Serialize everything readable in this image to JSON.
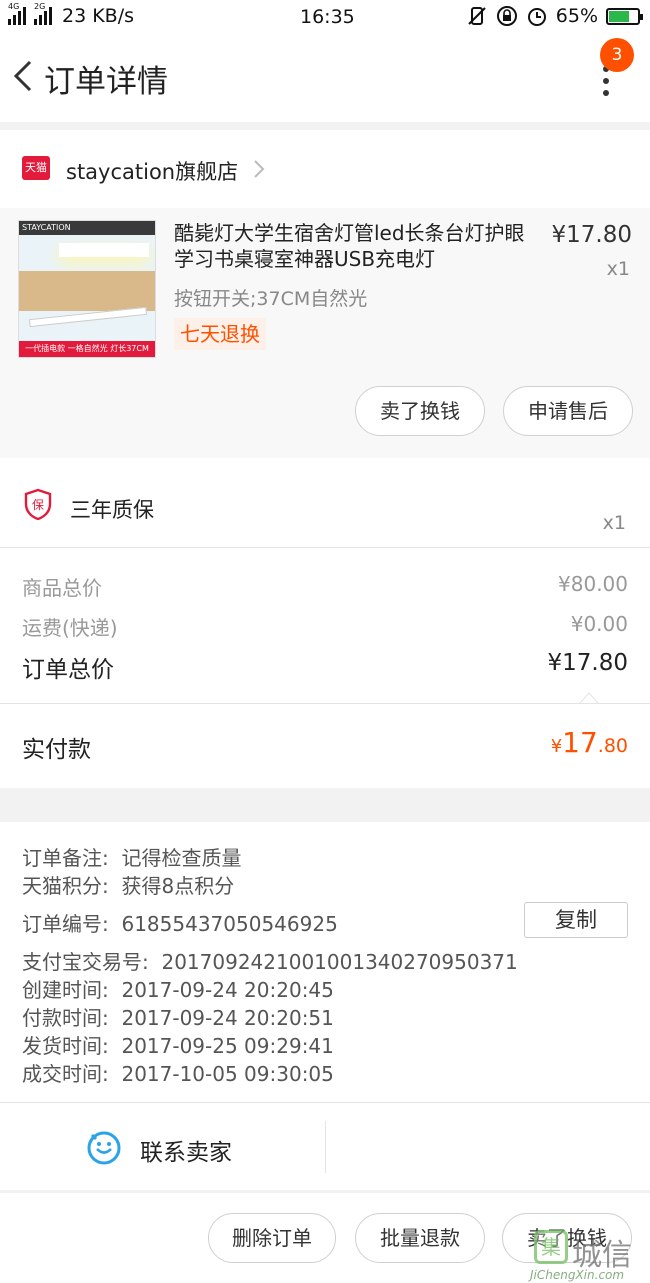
{
  "status_bar": {
    "signal1_tag": "4G",
    "signal2_tag": "2G",
    "net_speed": "23 KB/s",
    "time": "16:35",
    "battery": "65%"
  },
  "header": {
    "title": "订单详情",
    "badge_count": "3"
  },
  "shop": {
    "platform_icon_text": "天猫",
    "name": "staycation旗舰店"
  },
  "product": {
    "image_brand": "STAYCATION",
    "image_caption": "一代插电款 一格自然光 灯长37CM",
    "title": "酷毙灯大学生宿舍灯管led长条台灯护眼学习书桌寝室神器USB充电灯",
    "price": "¥17.80",
    "qty": "x1",
    "sku": "按钮开关;37CM自然光",
    "return_tag": "七天退换",
    "sell_button": "卖了换钱",
    "aftersale_button": "申请售后"
  },
  "warranty": {
    "icon_text": "保",
    "name": "三年质保",
    "qty": "x1"
  },
  "prices": {
    "goods_label": "商品总价",
    "goods_value": "¥80.00",
    "shipping_label": "运费(快递)",
    "shipping_value": "¥0.00",
    "total_label": "订单总价",
    "total_value": "¥17.80"
  },
  "paid": {
    "label": "实付款",
    "currency": "¥",
    "int": "17",
    "dec": ".80"
  },
  "info": {
    "remark_label": "订单备注:",
    "remark_value": "记得检查质量",
    "points_label": "天猫积分:",
    "points_value": "获得8点积分",
    "order_no_label": "订单编号:",
    "order_no_value": "61855437050546925",
    "copy_button": "复制",
    "alipay_label": "支付宝交易号:",
    "alipay_value": "2017092421001001340270950371",
    "created_label": "创建时间:",
    "created_value": "2017-09-24 20:20:45",
    "paid_label": "付款时间:",
    "paid_value": "2017-09-24 20:20:51",
    "shipped_label": "发货时间:",
    "shipped_value": "2017-09-25 09:29:41",
    "done_label": "成交时间:",
    "done_value": "2017-10-05 09:30:05"
  },
  "contact": {
    "label": "联系卖家"
  },
  "bottom_actions": {
    "delete": "删除订单",
    "batch_refund": "批量退款",
    "sell": "卖了换钱"
  },
  "watermark": {
    "box_char": "集",
    "big_text": "城信",
    "small_text": "JiChengXin.com"
  },
  "colors": {
    "accent": "#ff5000",
    "tmall_red": "#e21b3c",
    "chat_blue": "#2aa3e8"
  }
}
